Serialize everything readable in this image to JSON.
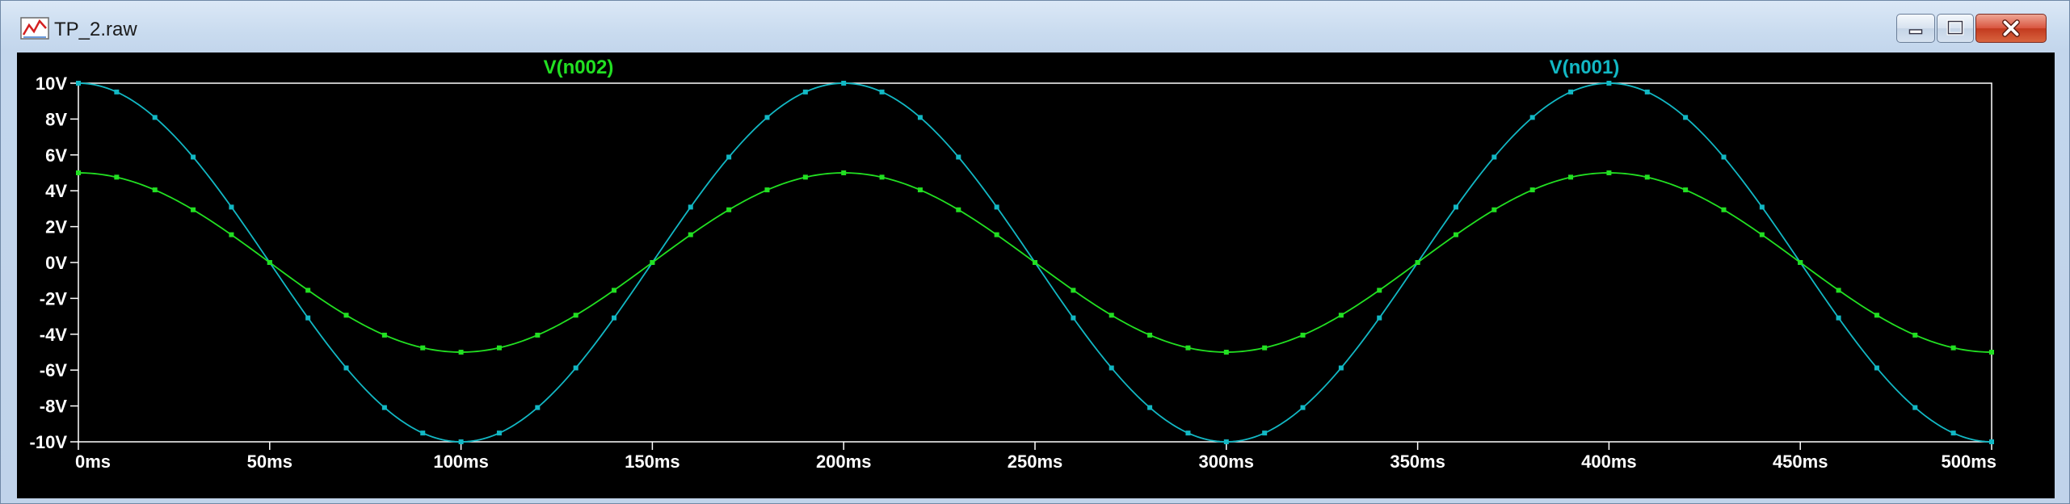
{
  "window": {
    "title": "TP_2.raw",
    "icon": "waveform-plot-icon",
    "controls": {
      "minimize_icon": "minimize-icon",
      "maximize_icon": "maximize-icon",
      "close_icon": "close-icon"
    },
    "colors": {
      "close": "#c8412a",
      "plot_background": "#000000",
      "axis": "#ffffff"
    }
  },
  "chart_data": {
    "type": "line",
    "title": "",
    "xlabel": "",
    "ylabel": "",
    "xlim": [
      0,
      500
    ],
    "ylim": [
      -10,
      10
    ],
    "x_unit": "ms",
    "y_unit": "V",
    "x_ticks": [
      0,
      50,
      100,
      150,
      200,
      250,
      300,
      350,
      400,
      450,
      500
    ],
    "x_tick_labels": [
      "0ms",
      "50ms",
      "100ms",
      "150ms",
      "200ms",
      "250ms",
      "300ms",
      "350ms",
      "400ms",
      "450ms",
      "500ms"
    ],
    "y_ticks": [
      10,
      8,
      6,
      4,
      2,
      0,
      -2,
      -4,
      -6,
      -8,
      -10
    ],
    "y_tick_labels": [
      "10V",
      "8V",
      "6V",
      "4V",
      "2V",
      "0V",
      "-2V",
      "-4V",
      "-6V",
      "-8V",
      "-10V"
    ],
    "grid": false,
    "legend": "top, series names above plot",
    "series": [
      {
        "name": "V(n002)",
        "color": "#22e022",
        "x": [
          0,
          10,
          20,
          30,
          40,
          50,
          60,
          70,
          80,
          90,
          100,
          110,
          120,
          130,
          140,
          150,
          160,
          170,
          180,
          190,
          200,
          210,
          220,
          230,
          240,
          250,
          260,
          270,
          280,
          290,
          300,
          310,
          320,
          330,
          340,
          350,
          360,
          370,
          380,
          390,
          400,
          410,
          420,
          430,
          440,
          450,
          460,
          470,
          480,
          490,
          500
        ],
        "values": [
          5,
          4.76,
          4.05,
          2.94,
          1.55,
          0,
          -1.55,
          -2.94,
          -4.05,
          -4.76,
          -5,
          -4.76,
          -4.05,
          -2.94,
          -1.55,
          0,
          1.55,
          2.94,
          4.05,
          4.76,
          5,
          4.76,
          4.05,
          2.94,
          1.55,
          0,
          -1.55,
          -2.94,
          -4.05,
          -4.76,
          -5,
          -4.76,
          -4.05,
          -2.94,
          -1.55,
          0,
          1.55,
          2.94,
          4.05,
          4.76,
          5,
          4.76,
          4.05,
          2.94,
          1.55,
          0,
          -1.55,
          -2.94,
          -4.05,
          -4.76,
          -5
        ]
      },
      {
        "name": "V(n001)",
        "color": "#12b8c4",
        "x": [
          0,
          10,
          20,
          30,
          40,
          50,
          60,
          70,
          80,
          90,
          100,
          110,
          120,
          130,
          140,
          150,
          160,
          170,
          180,
          190,
          200,
          210,
          220,
          230,
          240,
          250,
          260,
          270,
          280,
          290,
          300,
          310,
          320,
          330,
          340,
          350,
          360,
          370,
          380,
          390,
          400,
          410,
          420,
          430,
          440,
          450,
          460,
          470,
          480,
          490,
          500
        ],
        "values": [
          10,
          9.51,
          8.09,
          5.88,
          3.09,
          0,
          -3.09,
          -5.88,
          -8.09,
          -9.51,
          -10,
          -9.51,
          -8.09,
          -5.88,
          -3.09,
          0,
          3.09,
          5.88,
          8.09,
          9.51,
          10,
          9.51,
          8.09,
          5.88,
          3.09,
          0,
          -3.09,
          -5.88,
          -8.09,
          -9.51,
          -10,
          -9.51,
          -8.09,
          -5.88,
          -3.09,
          0,
          3.09,
          5.88,
          8.09,
          9.51,
          10,
          9.51,
          8.09,
          5.88,
          3.09,
          0,
          -3.09,
          -5.88,
          -8.09,
          -9.51,
          -10
        ]
      }
    ]
  }
}
